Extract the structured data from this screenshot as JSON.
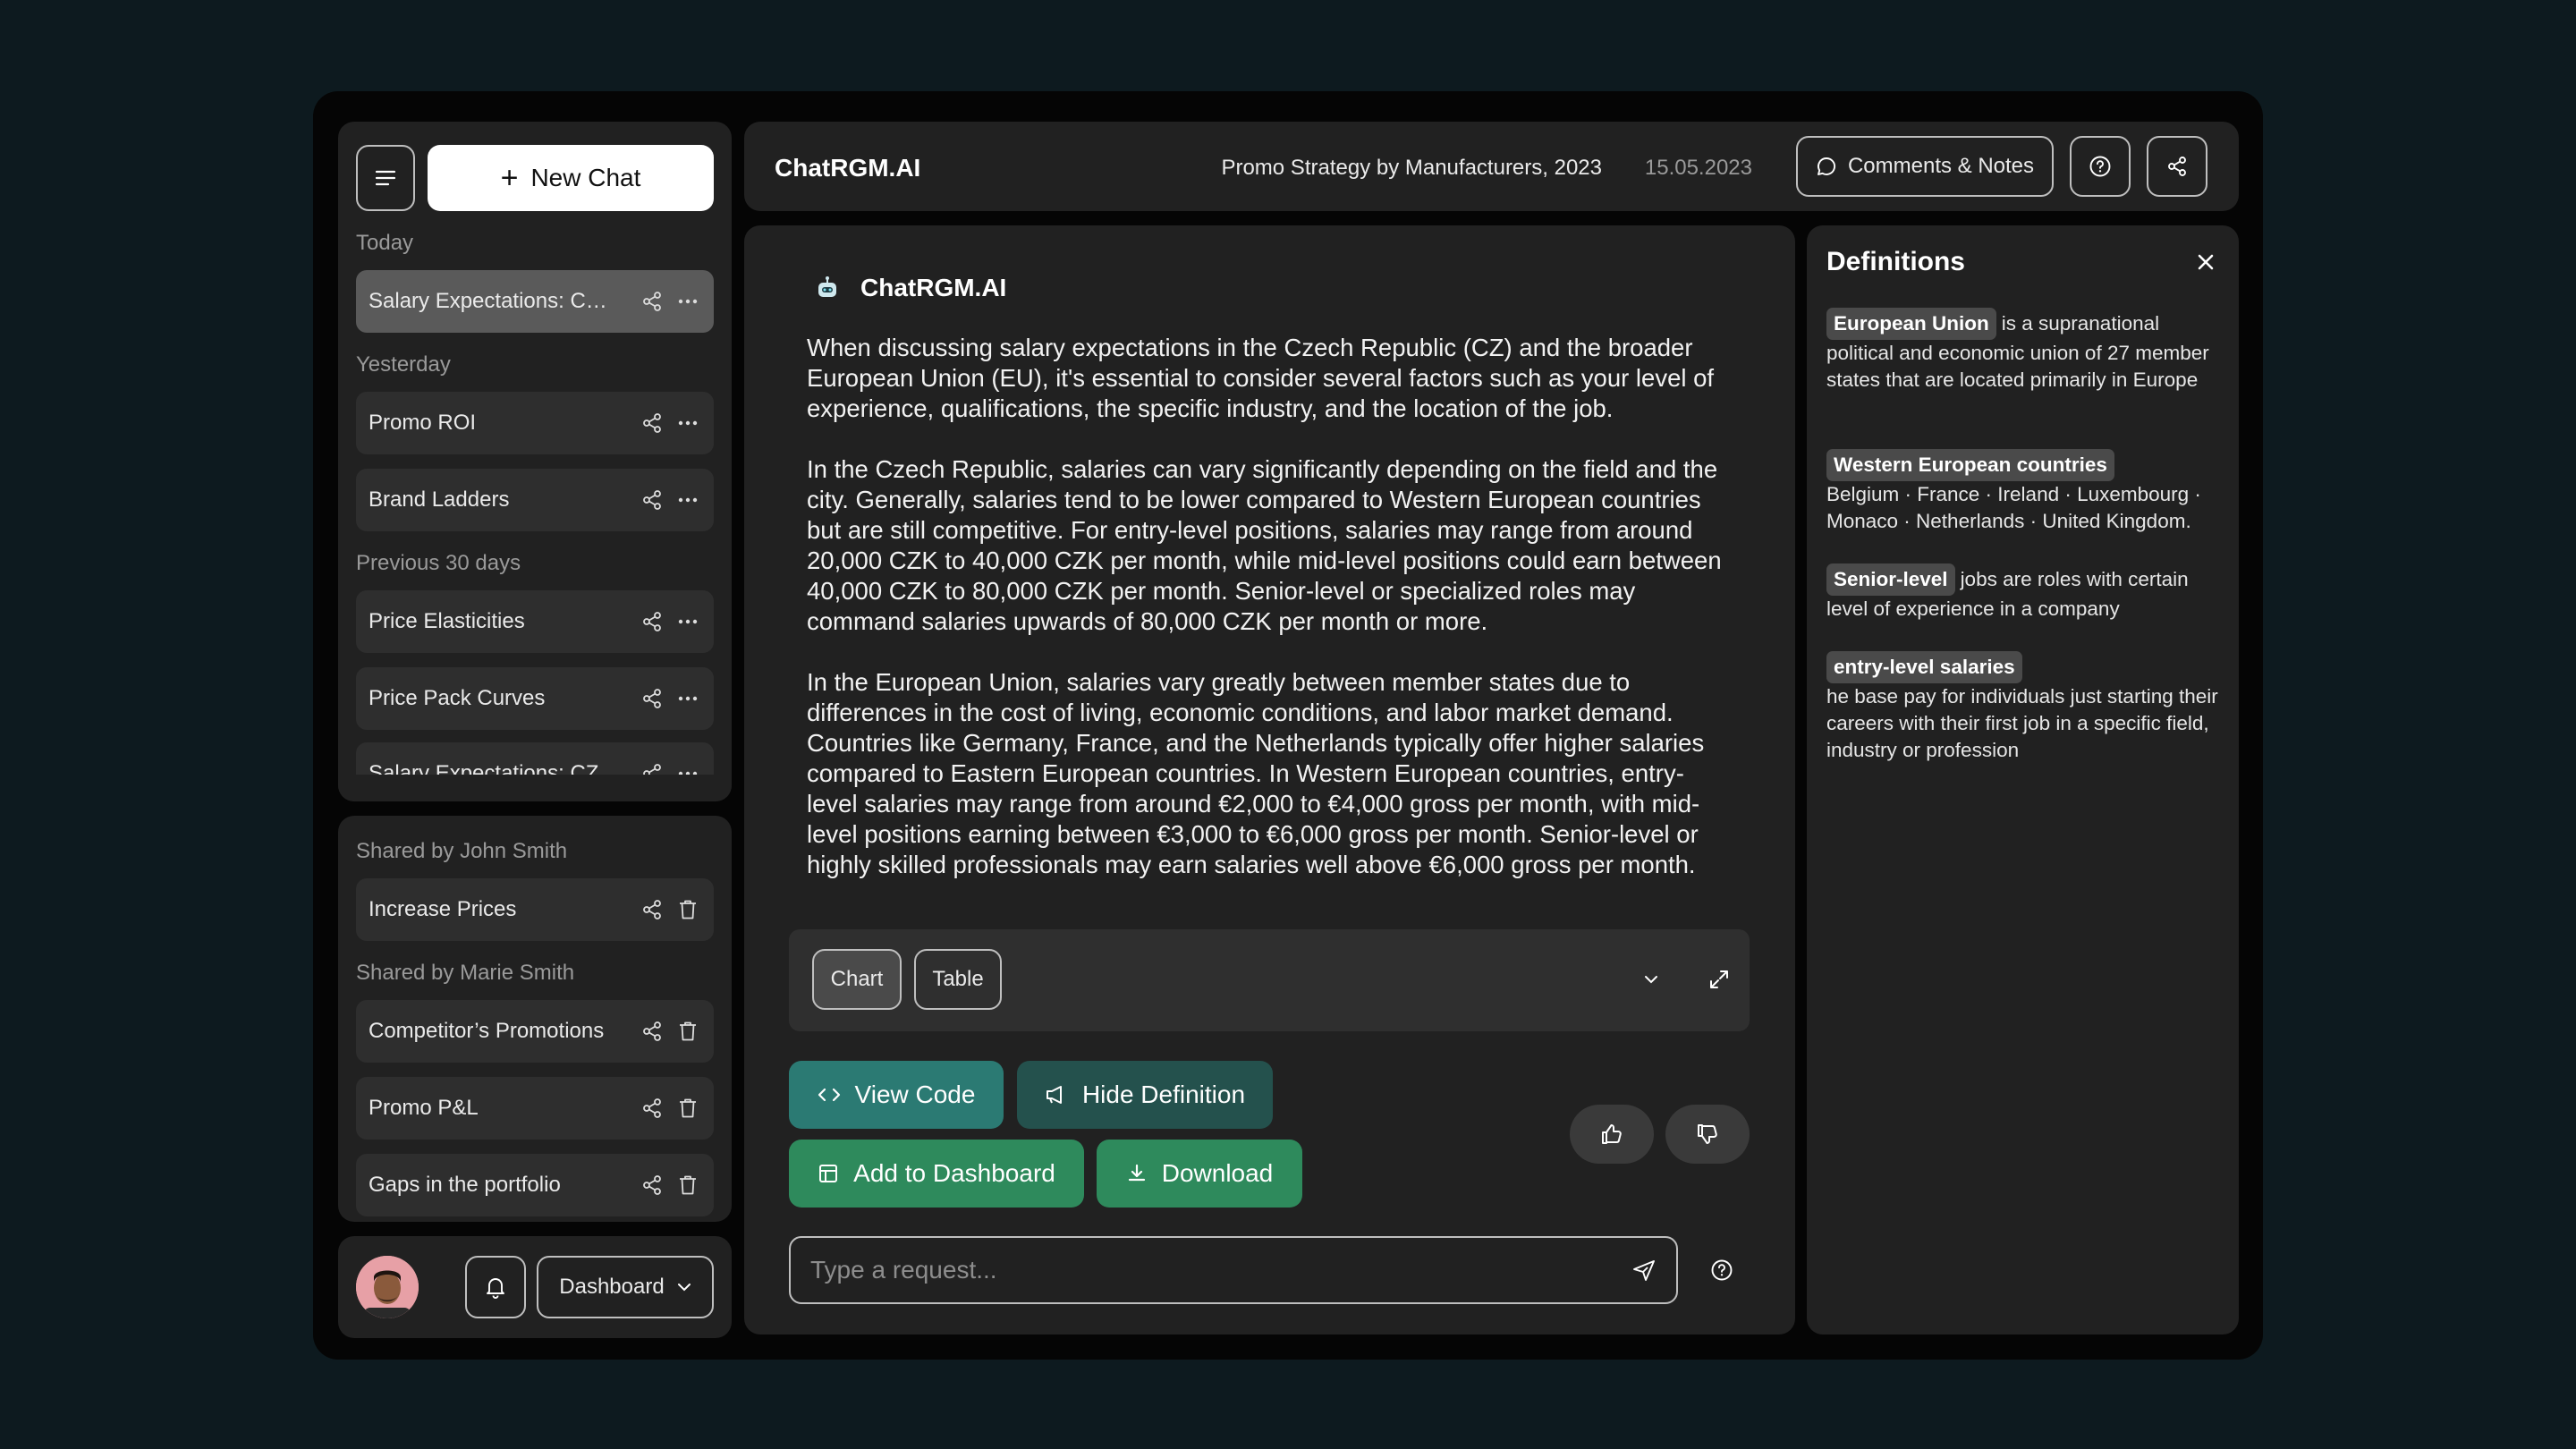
{
  "sidebar": {
    "new_chat_label": "New Chat",
    "groups": {
      "today": "Today",
      "yesterday": "Yesterday",
      "previous": "Previous 30 days"
    },
    "chats": [
      {
        "label": "Salary Expectations: CZ and EU"
      },
      {
        "label": "Promo ROI"
      },
      {
        "label": "Brand Ladders"
      },
      {
        "label": "Price Elasticities"
      },
      {
        "label": "Price Pack Curves"
      },
      {
        "label": "Salary Expectations: CZ"
      }
    ],
    "shared": {
      "john_label": "Shared by John Smith",
      "marie_label": "Shared by Marie Smith",
      "items": [
        {
          "label": "Increase Prices"
        },
        {
          "label": "Competitor’s Promotions"
        },
        {
          "label": "Promo P&L"
        },
        {
          "label": "Gaps in the portfolio"
        }
      ]
    },
    "footer": {
      "dashboard_label": "Dashboard"
    }
  },
  "header": {
    "brand": "ChatRGM.AI",
    "doc_title": "Promo Strategy by Manufacturers, 2023",
    "doc_date": "15.05.2023",
    "comments_label": "Comments & Notes"
  },
  "message": {
    "sender": "ChatRGM.AI",
    "paragraphs": [
      "When discussing salary expectations in the Czech Republic (CZ) and the broader European Union (EU), it's essential to consider several factors such as your level of experience, qualifications, the specific industry, and the location of the job.",
      "In the Czech Republic, salaries can vary significantly depending on the field and the city. Generally, salaries tend to be lower compared to Western European countries but are still competitive. For entry-level positions, salaries may range from around 20,000 CZK to 40,000 CZK per month, while mid-level positions could earn between 40,000 CZK to 80,000 CZK per month. Senior-level or specialized roles may command salaries upwards of 80,000 CZK per month or more.",
      "In the European Union, salaries vary greatly between member states due to differences in the cost of living, economic conditions, and labor market demand. Countries like Germany, France, and the Netherlands typically offer higher salaries compared to Eastern European countries. In Western European countries, entry-level salaries may range from around €2,000 to €4,000 gross per month, with mid-level positions earning between €3,000 to €6,000 gross per month. Senior-level or highly skilled professionals may earn salaries well above €6,000 gross per month."
    ]
  },
  "viz": {
    "chart_label": "Chart",
    "table_label": "Table"
  },
  "actions": {
    "view_code": "View Code",
    "hide_definition": "Hide Definition",
    "add_dashboard": "Add to Dashboard",
    "download": "Download"
  },
  "composer": {
    "placeholder": "Type a request..."
  },
  "definitions": {
    "title": "Definitions",
    "items": [
      {
        "term": "European Union",
        "text": "is a supranational political and economic union of 27 member states that are located primarily in Europe"
      },
      {
        "term": "Western European countries",
        "text": "Belgium · France · Ireland · Luxembourg · Monaco · Netherlands · United Kingdom."
      },
      {
        "term": "Senior-level",
        "text": "jobs are roles with certain level of experience in a company"
      },
      {
        "term": "entry-level salaries",
        "text": "he base pay for individuals just starting their careers with their first job in a specific field, industry or profession"
      }
    ]
  },
  "colors": {
    "accent_teal": "#2b7a73",
    "accent_dark_teal": "#24514d",
    "accent_green": "#2e8a5c",
    "panel": "#212121"
  },
  "icons": [
    "menu-icon",
    "plus-icon",
    "share-icon",
    "more-icon",
    "trash-icon",
    "bell-icon",
    "chevron-down-icon",
    "comment-icon",
    "help-icon",
    "robot-icon",
    "expand-icon",
    "code-icon",
    "megaphone-icon",
    "dashboard-icon",
    "download-icon",
    "thumbs-up-icon",
    "thumbs-down-icon",
    "send-icon",
    "close-icon"
  ]
}
